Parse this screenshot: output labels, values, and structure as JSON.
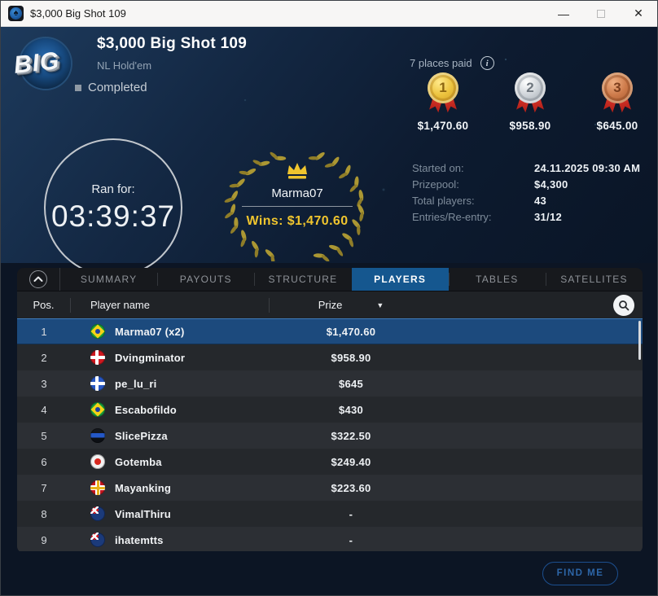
{
  "window": {
    "title": "$3,000 Big Shot 109",
    "controls": {
      "minimize": "—",
      "close": "✕"
    }
  },
  "header": {
    "logo_text": "BIG",
    "title": "$3,000 Big Shot 109",
    "game_type": "NL Hold'em",
    "status": "Completed",
    "places_paid": "7 places paid",
    "medals": [
      {
        "place": "1",
        "amount": "$1,470.60",
        "color": "#e3b62e"
      },
      {
        "place": "2",
        "amount": "$958.90",
        "color": "#c3c8cd"
      },
      {
        "place": "3",
        "amount": "$645.00",
        "color": "#c06a42"
      }
    ],
    "timer": {
      "label": "Ran for:",
      "time": "03:39:37"
    },
    "winner": {
      "name": "Marma07",
      "wins": "Wins: $1,470.60"
    },
    "stats": [
      {
        "label": "Started on:",
        "value": "24.11.2025   09:30 AM"
      },
      {
        "label": "Prizepool:",
        "value": "$4,300"
      },
      {
        "label": "Total players:",
        "value": "43"
      },
      {
        "label": "Entries/Re-entry:",
        "value": "31/12"
      }
    ]
  },
  "tabs": [
    {
      "label": "SUMMARY",
      "active": false
    },
    {
      "label": "PAYOUTS",
      "active": false
    },
    {
      "label": "STRUCTURE",
      "active": false
    },
    {
      "label": "PLAYERS",
      "active": true
    },
    {
      "label": "TABLES",
      "active": false
    },
    {
      "label": "SATELLITES",
      "active": false
    }
  ],
  "table": {
    "columns": {
      "pos": "Pos.",
      "player": "Player name",
      "prize": "Prize"
    },
    "rows": [
      {
        "pos": "1",
        "player": "Marma07 (x2)",
        "prize": "$1,470.60",
        "flag": "brazil",
        "highlighted": true
      },
      {
        "pos": "2",
        "player": "Dvingminator",
        "prize": "$958.90",
        "flag": "denmark",
        "highlighted": false
      },
      {
        "pos": "3",
        "player": "pe_lu_ri",
        "prize": "$645",
        "flag": "finland",
        "highlighted": false
      },
      {
        "pos": "4",
        "player": "Escabofildo",
        "prize": "$430",
        "flag": "brazil",
        "highlighted": false
      },
      {
        "pos": "5",
        "player": "SlicePizza",
        "prize": "$322.50",
        "flag": "estonia",
        "highlighted": false
      },
      {
        "pos": "6",
        "player": "Gotemba",
        "prize": "$249.40",
        "flag": "japan",
        "highlighted": false
      },
      {
        "pos": "7",
        "player": "Mayanking",
        "prize": "$223.60",
        "flag": "guernsey",
        "highlighted": false
      },
      {
        "pos": "8",
        "player": "VimalThiru",
        "prize": "-",
        "flag": "australia",
        "highlighted": false
      },
      {
        "pos": "9",
        "player": "ihatemtts",
        "prize": "-",
        "flag": "australia",
        "highlighted": false
      }
    ]
  },
  "footer": {
    "find_me_label": "FIND ME"
  },
  "colors": {
    "active_tab": "#15578f",
    "highlight_row": "#1c4a7d",
    "accent_gold": "#f0c52e",
    "ribbon_red": "#d42a22"
  }
}
